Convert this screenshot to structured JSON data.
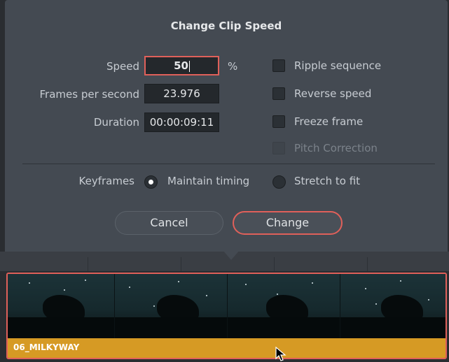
{
  "dialog": {
    "title": "Change Clip Speed",
    "speed": {
      "label": "Speed",
      "value": "50",
      "unit": "%"
    },
    "fps": {
      "label": "Frames per second",
      "value": "23.976"
    },
    "duration": {
      "label": "Duration",
      "value": "00:00:09:11"
    },
    "options": [
      {
        "label": "Ripple sequence",
        "checked": false,
        "enabled": true
      },
      {
        "label": "Reverse speed",
        "checked": false,
        "enabled": true
      },
      {
        "label": "Freeze frame",
        "checked": false,
        "enabled": true
      },
      {
        "label": "Pitch Correction",
        "checked": false,
        "enabled": false
      }
    ],
    "keyframes": {
      "label": "Keyframes",
      "maintain": "Maintain timing",
      "stretch": "Stretch to fit",
      "selected": "Maintain timing"
    },
    "buttons": {
      "cancel": "Cancel",
      "change": "Change"
    }
  },
  "timeline": {
    "clip_name": "06_MILKYWAY",
    "clip_color": "#d69a24",
    "highlight_color": "#e0605a"
  }
}
